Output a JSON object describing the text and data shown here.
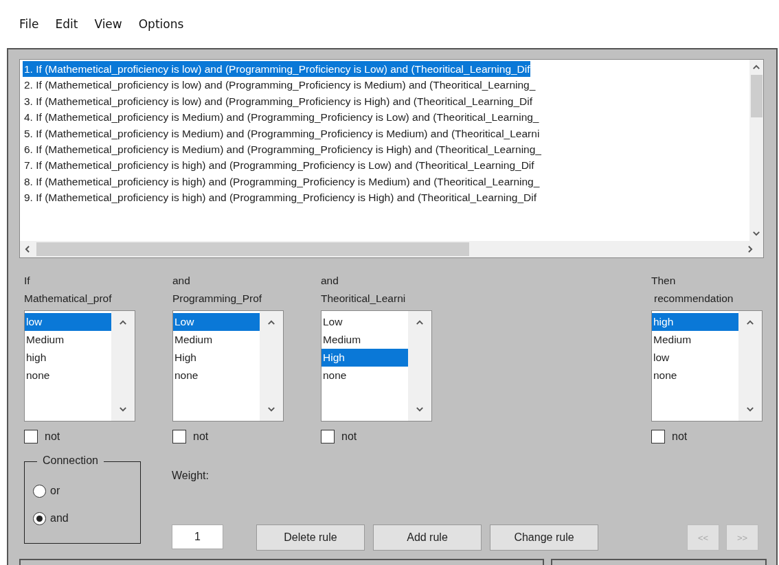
{
  "menu": [
    {
      "label": "File"
    },
    {
      "label": "Edit"
    },
    {
      "label": "View"
    },
    {
      "label": "Options"
    }
  ],
  "rules": [
    {
      "text": "1. If (Mathemetical_proficiency is low) and (Programming_Proficiency is Low) and (Theoritical_Learning_Dif",
      "selected": true
    },
    {
      "text": "2. If (Mathemetical_proficiency is low) and (Programming_Proficiency is Medium) and (Theoritical_Learning_",
      "selected": false
    },
    {
      "text": "3. If (Mathemetical_proficiency is low) and (Programming_Proficiency is High) and (Theoritical_Learning_Dif",
      "selected": false
    },
    {
      "text": "4. If (Mathemetical_proficiency is Medium) and (Programming_Proficiency is Low) and (Theoritical_Learning_",
      "selected": false
    },
    {
      "text": "5. If (Mathemetical_proficiency is Medium) and (Programming_Proficiency is Medium) and (Theoritical_Learni",
      "selected": false
    },
    {
      "text": "6. If (Mathemetical_proficiency is Medium) and (Programming_Proficiency is High) and (Theoritical_Learning_",
      "selected": false
    },
    {
      "text": "7. If (Mathemetical_proficiency is high) and (Programming_Proficiency is Low) and (Theoritical_Learning_Dif",
      "selected": false
    },
    {
      "text": "8. If (Mathemetical_proficiency is high) and (Programming_Proficiency is Medium) and (Theoritical_Learning_",
      "selected": false
    },
    {
      "text": "9. If (Mathemetical_proficiency is high) and (Programming_Proficiency is High) and (Theoritical_Learning_Dif",
      "selected": false
    }
  ],
  "variables": [
    {
      "kind": "input",
      "prefix": "If",
      "name": "Mathematical_prof",
      "options": [
        {
          "label": "low",
          "selected": true
        },
        {
          "label": "Medium",
          "selected": false
        },
        {
          "label": "high",
          "selected": false
        },
        {
          "label": "none",
          "selected": false
        }
      ],
      "not_label": "not",
      "not_checked": false
    },
    {
      "kind": "input",
      "prefix": "and",
      "name": "Programming_Prof",
      "options": [
        {
          "label": "Low",
          "selected": true
        },
        {
          "label": "Medium",
          "selected": false
        },
        {
          "label": "High",
          "selected": false
        },
        {
          "label": "none",
          "selected": false
        }
      ],
      "not_label": "not",
      "not_checked": false
    },
    {
      "kind": "input",
      "prefix": "and",
      "name": "Theoritical_Learni",
      "options": [
        {
          "label": "Low",
          "selected": false
        },
        {
          "label": "Medium",
          "selected": false
        },
        {
          "label": "High",
          "selected": true
        },
        {
          "label": "none",
          "selected": false
        }
      ],
      "not_label": "not",
      "not_checked": false
    },
    {
      "kind": "output",
      "prefix": "Then",
      "name": "recommendation",
      "options": [
        {
          "label": "high",
          "selected": true
        },
        {
          "label": "Medium",
          "selected": false
        },
        {
          "label": "low",
          "selected": false
        },
        {
          "label": "none",
          "selected": false
        }
      ],
      "not_label": "not",
      "not_checked": false
    }
  ],
  "connection": {
    "title": "Connection",
    "options": [
      {
        "label": "or",
        "selected": false
      },
      {
        "label": "and",
        "selected": true
      }
    ]
  },
  "weight": {
    "label": "Weight:",
    "value": "1"
  },
  "buttons": [
    {
      "label": "Delete rule"
    },
    {
      "label": "Add rule"
    },
    {
      "label": "Change rule"
    }
  ],
  "nav_buttons": [
    {
      "label": "<<",
      "disabled": true
    },
    {
      "label": ">>",
      "disabled": true
    }
  ]
}
